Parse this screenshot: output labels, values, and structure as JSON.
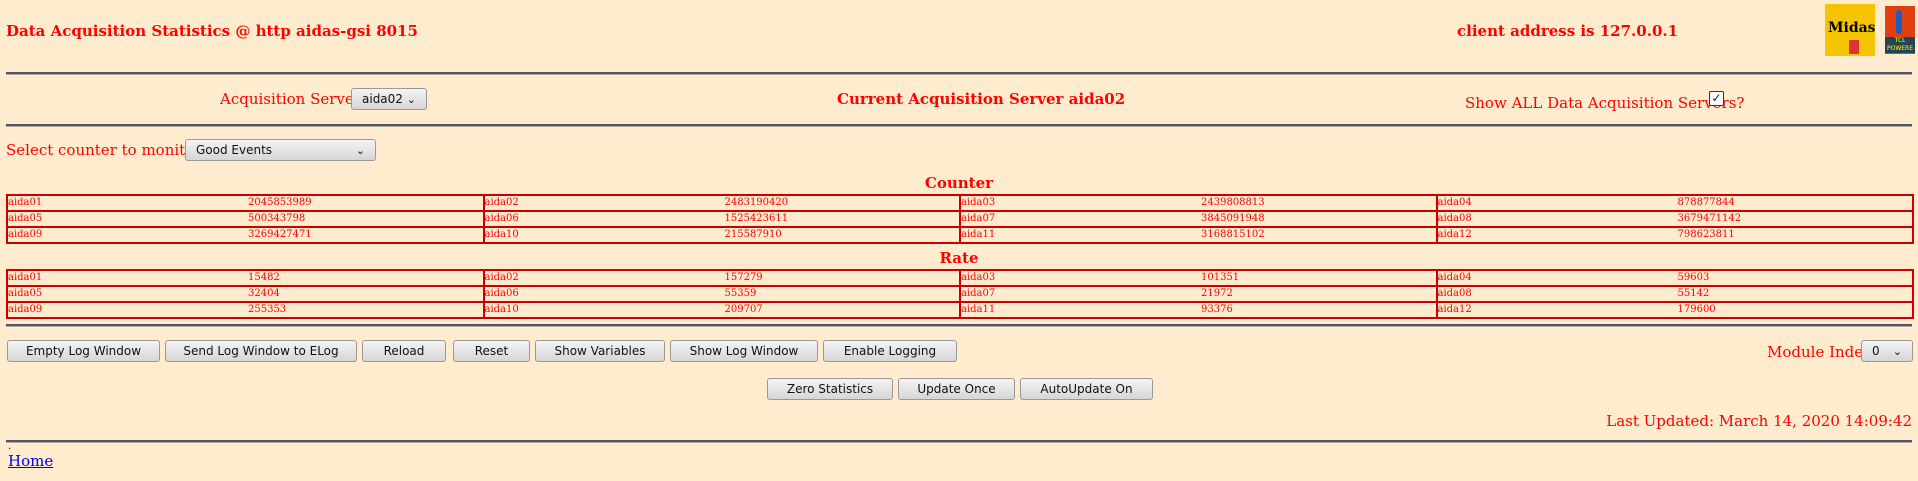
{
  "header": {
    "title": "Data Acquisition Statistics @ http aidas-gsi 8015",
    "client": "client address is 127.0.0.1",
    "logo_text": "Midas",
    "logo2_text": "TCL POWERED"
  },
  "servers": {
    "label": "Acquisition Servers",
    "selected": "aida02",
    "current": "Current Acquisition Server aida02",
    "show_all_label": "Show ALL Data Acquisition Servers?",
    "show_all_checked": true
  },
  "counter_select": {
    "label": "Select counter to monitor",
    "selected": "Good Events"
  },
  "counter": {
    "heading": "Counter",
    "rows": [
      [
        [
          "aida01",
          "2045853989"
        ],
        [
          "aida02",
          "2483190420"
        ],
        [
          "aida03",
          "2439808813"
        ],
        [
          "aida04",
          "878877844"
        ]
      ],
      [
        [
          "aida05",
          "500343798"
        ],
        [
          "aida06",
          "1525423611"
        ],
        [
          "aida07",
          "3845091948"
        ],
        [
          "aida08",
          "3679471142"
        ]
      ],
      [
        [
          "aida09",
          "3269427471"
        ],
        [
          "aida10",
          "215587910"
        ],
        [
          "aida11",
          "3168815102"
        ],
        [
          "aida12",
          "798623811"
        ]
      ]
    ]
  },
  "rate": {
    "heading": "Rate",
    "rows": [
      [
        [
          "aida01",
          "15482"
        ],
        [
          "aida02",
          "157279"
        ],
        [
          "aida03",
          "101351"
        ],
        [
          "aida04",
          "59603"
        ]
      ],
      [
        [
          "aida05",
          "32404"
        ],
        [
          "aida06",
          "55359"
        ],
        [
          "aida07",
          "21972"
        ],
        [
          "aida08",
          "55142"
        ]
      ],
      [
        [
          "aida09",
          "255353"
        ],
        [
          "aida10",
          "209707"
        ],
        [
          "aida11",
          "93376"
        ],
        [
          "aida12",
          "179600"
        ]
      ]
    ]
  },
  "buttons": {
    "empty_log": "Empty Log Window",
    "send_log": "Send Log Window to ELog",
    "reload": "Reload",
    "reset": "Reset",
    "show_vars": "Show Variables",
    "show_log": "Show Log Window",
    "enable_logging": "Enable Logging",
    "zero_stats": "Zero Statistics",
    "update_once": "Update Once",
    "autoupdate": "AutoUpdate On"
  },
  "module": {
    "label": "Module Index",
    "selected": "0"
  },
  "last_updated": "Last Updated: March 14, 2020 14:09:42",
  "footer": {
    "dot": ".",
    "home": "Home"
  },
  "colors": {
    "background": "#ffebcd",
    "text": "#ff0000",
    "table_border": "#cc0000"
  }
}
